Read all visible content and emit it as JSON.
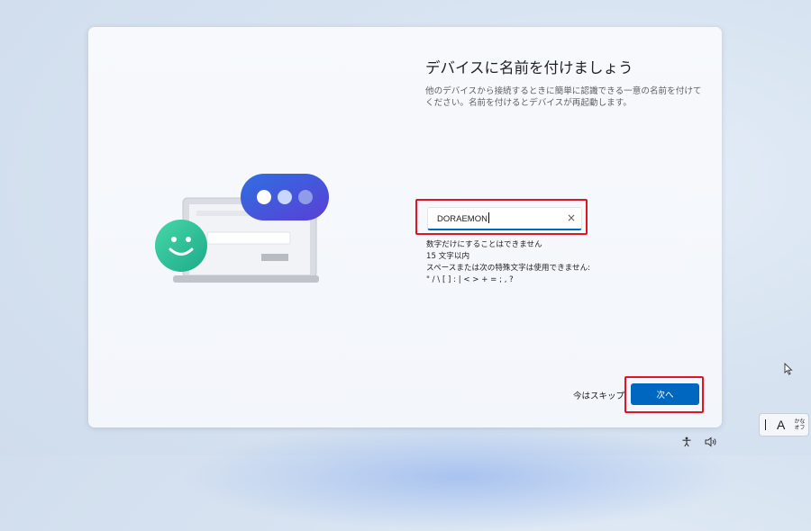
{
  "dialog": {
    "title": "デバイスに名前を付けましょう",
    "description": "他のデバイスから接続するときに簡単に認識できる一意の名前を付けてください。名前を付けるとデバイスが再起動します。"
  },
  "name_input": {
    "value": "DORAEMON",
    "clear_icon": "×"
  },
  "rules": [
    "数字だけにすることはできません",
    "15 文字以内",
    "スペースまたは次の特殊文字は使用できません:",
    "\" / \\ [ ] : | < > + = ; , ?"
  ],
  "actions": {
    "skip_label": "今はスキップ",
    "next_label": "次へ"
  },
  "ime": {
    "mode": "A",
    "kana_line1": "かな",
    "kana_line2": "オフ"
  },
  "icons": {
    "cursor": "mouse-pointer-icon",
    "accessibility": "accessibility-icon",
    "volume": "volume-icon"
  },
  "colors": {
    "accent": "#0067c0",
    "highlight": "#e01424",
    "avatar_green": "#2fc79a",
    "bubble_blue": "#3b5bd9"
  }
}
